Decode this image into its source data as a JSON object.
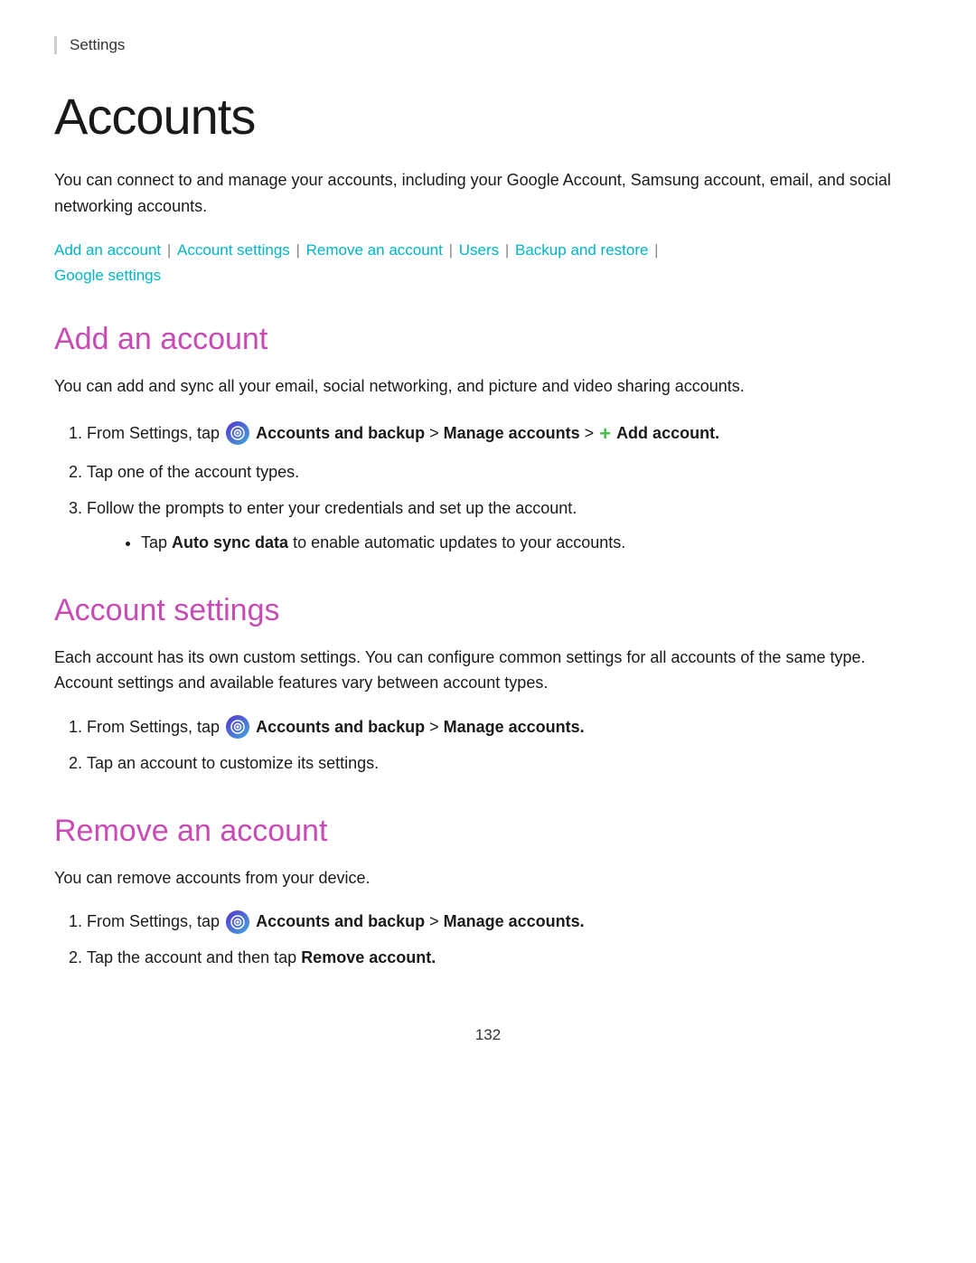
{
  "breadcrumb": "Settings",
  "page_title": "Accounts",
  "intro_text": "You can connect to and manage your accounts, including your Google Account, Samsung account, email, and social networking accounts.",
  "nav_links": [
    {
      "label": "Add an account",
      "id": "add-an-account"
    },
    {
      "label": "Account settings",
      "id": "account-settings"
    },
    {
      "label": "Remove an account",
      "id": "remove-an-account"
    },
    {
      "label": "Users",
      "id": "users"
    },
    {
      "label": "Backup and restore",
      "id": "backup-and-restore"
    },
    {
      "label": "Google settings",
      "id": "google-settings"
    }
  ],
  "sections": [
    {
      "id": "add-an-account",
      "title": "Add an account",
      "intro": "You can add and sync all your email, social networking, and picture and video sharing accounts.",
      "steps": [
        {
          "type": "icon-step",
          "text_before": "From Settings, tap",
          "icon": "accounts-backup-icon",
          "text_after": "Accounts and backup > Manage accounts >",
          "plus": true,
          "bold_end": "Add account."
        },
        {
          "type": "plain",
          "text": "Tap one of the account types."
        },
        {
          "type": "plain",
          "text": "Follow the prompts to enter your credentials and set up the account.",
          "sub": [
            {
              "text_before": "Tap",
              "bold": "Auto sync data",
              "text_after": "to enable automatic updates to your accounts."
            }
          ]
        }
      ]
    },
    {
      "id": "account-settings",
      "title": "Account settings",
      "intro": "Each account has its own custom settings. You can configure common settings for all accounts of the same type. Account settings and available features vary between account types.",
      "steps": [
        {
          "type": "icon-step",
          "text_before": "From Settings, tap",
          "icon": "accounts-backup-icon",
          "text_after": "Accounts and backup > Manage accounts.",
          "plus": false,
          "bold_end": null
        },
        {
          "type": "plain",
          "text": "Tap an account to customize its settings."
        }
      ]
    },
    {
      "id": "remove-an-account",
      "title": "Remove an account",
      "intro": "You can remove accounts from your device.",
      "steps": [
        {
          "type": "icon-step",
          "text_before": "From Settings, tap",
          "icon": "accounts-backup-icon",
          "text_after": "Accounts and backup > Manage accounts.",
          "plus": false,
          "bold_end": null
        },
        {
          "type": "plain-with-bold",
          "text_before": "Tap the account and then tap",
          "bold": "Remove account.",
          "text_after": ""
        }
      ]
    }
  ],
  "page_number": "132"
}
